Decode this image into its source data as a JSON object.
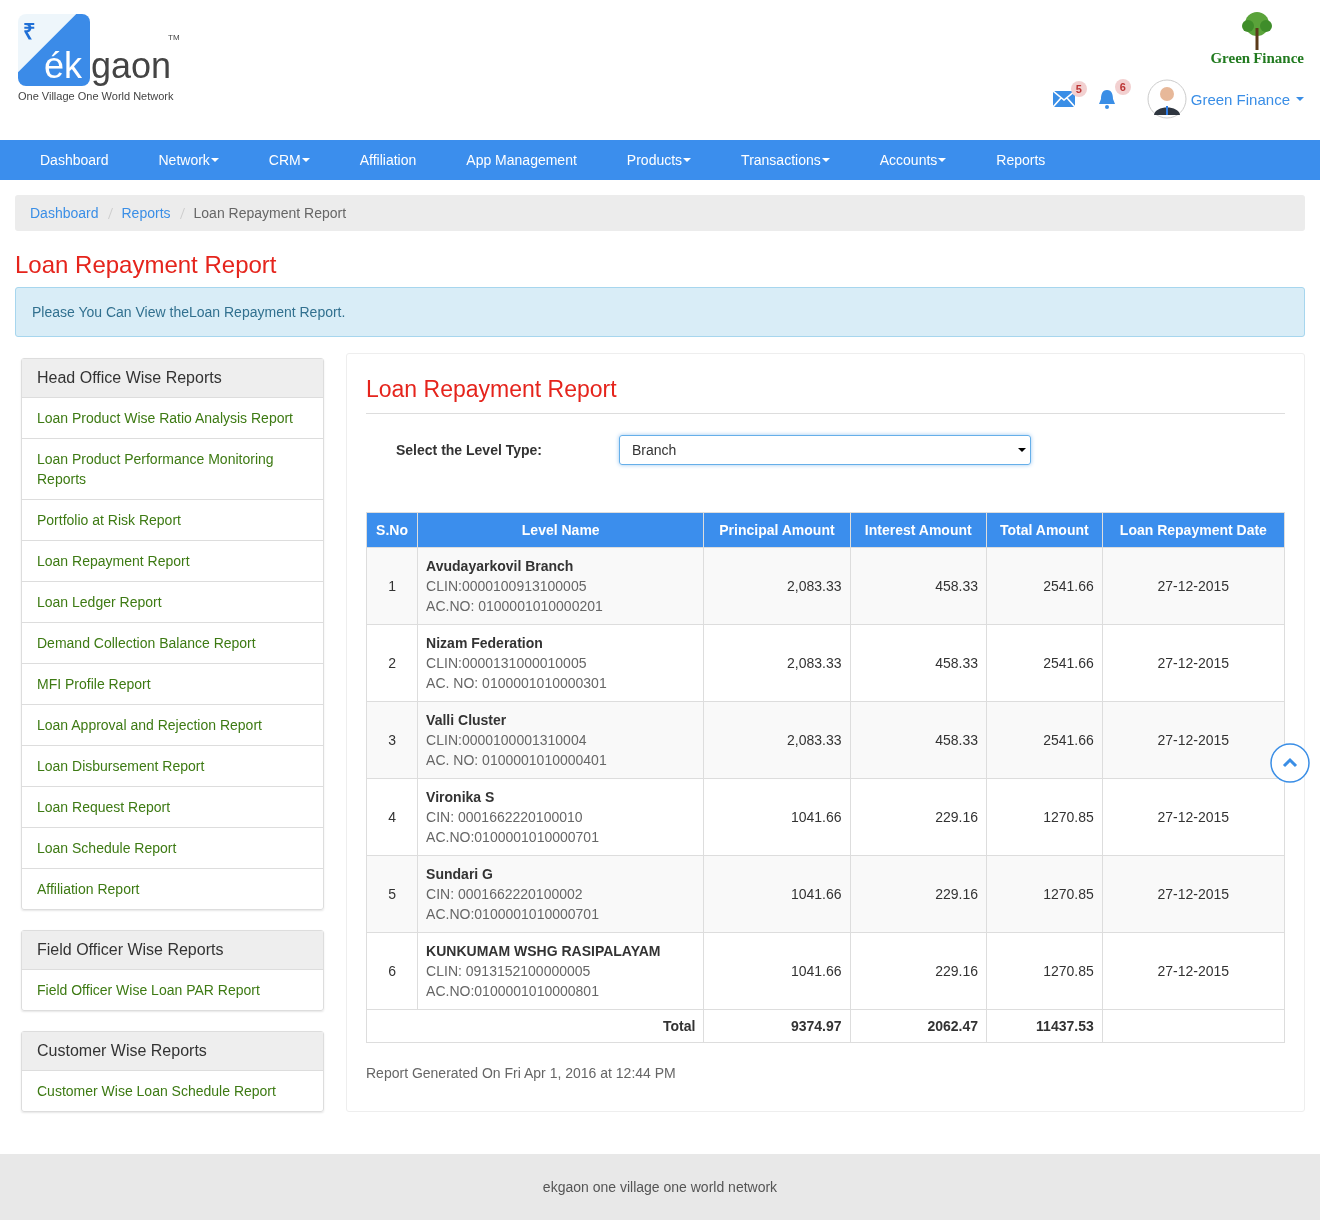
{
  "logo": {
    "rupee": "₹",
    "ek": "ék",
    "gaon": "gaon",
    "tm": "TM",
    "tagline": "One Village One World Network"
  },
  "partner_logo": {
    "word1": "Green",
    "word2": "Finance"
  },
  "header": {
    "mail_count": "5",
    "alert_count": "6",
    "user": "Green Finance"
  },
  "nav": [
    {
      "label": "Dashboard",
      "dropdown": false
    },
    {
      "label": "Network",
      "dropdown": true
    },
    {
      "label": "CRM",
      "dropdown": true
    },
    {
      "label": "Affiliation",
      "dropdown": false
    },
    {
      "label": "App Management",
      "dropdown": false
    },
    {
      "label": "Products",
      "dropdown": true
    },
    {
      "label": "Transactions",
      "dropdown": true
    },
    {
      "label": "Accounts",
      "dropdown": true
    },
    {
      "label": "Reports",
      "dropdown": false
    }
  ],
  "breadcrumb": [
    {
      "label": "Dashboard",
      "current": false
    },
    {
      "label": "Reports",
      "current": false
    },
    {
      "label": "Loan Repayment Report",
      "current": true
    }
  ],
  "page_title": "Loan Repayment Report",
  "info": "Please You Can View theLoan Repayment Report.",
  "sidebar": [
    {
      "title": "Head Office Wise Reports",
      "items": [
        "Loan Product Wise Ratio Analysis Report",
        "Loan Product Performance Monitoring Reports",
        "Portfolio at Risk Report",
        "Loan Repayment Report",
        "Loan Ledger Report",
        "Demand Collection Balance Report",
        "MFI Profile Report",
        "Loan Approval and Rejection Report",
        "Loan Disbursement Report",
        "Loan Request Report",
        "Loan Schedule Report",
        "Affiliation Report"
      ]
    },
    {
      "title": "Field Officer Wise Reports",
      "items": [
        "Field Officer Wise Loan PAR Report"
      ]
    },
    {
      "title": "Customer Wise Reports",
      "items": [
        "Customer Wise Loan Schedule Report"
      ]
    }
  ],
  "panel": {
    "title": "Loan Repayment Report",
    "level_label": "Select the Level Type:",
    "level_value": "Branch",
    "columns": [
      "S.No",
      "Level Name",
      "Principal Amount",
      "Interest Amount",
      "Total Amount",
      "Loan Repayment Date"
    ],
    "rows": [
      {
        "sno": "1",
        "name": "Avudayarkovil Branch",
        "line1": "CLIN:0000100913100005",
        "line2": "AC.NO: 0100001010000201",
        "principal": "2,083.33",
        "interest": "458.33",
        "total": "2541.66",
        "date": "27-12-2015"
      },
      {
        "sno": "2",
        "name": "Nizam Federation",
        "line1": "CLIN:0000131000010005",
        "line2": "AC. NO: 0100001010000301",
        "principal": "2,083.33",
        "interest": "458.33",
        "total": "2541.66",
        "date": "27-12-2015"
      },
      {
        "sno": "3",
        "name": "Valli Cluster",
        "line1": "CLIN:0000100001310004",
        "line2": "AC. NO: 0100001010000401",
        "principal": "2,083.33",
        "interest": "458.33",
        "total": "2541.66",
        "date": "27-12-2015"
      },
      {
        "sno": "4",
        "name": "Vironika S",
        "line1": "CIN: 0001662220100010",
        "line2": "AC.NO:0100001010000701",
        "principal": "1041.66",
        "interest": "229.16",
        "total": "1270.85",
        "date": "27-12-2015"
      },
      {
        "sno": "5",
        "name": "Sundari G",
        "line1": "CIN: 0001662220100002",
        "line2": "AC.NO:0100001010000701",
        "principal": "1041.66",
        "interest": "229.16",
        "total": "1270.85",
        "date": "27-12-2015"
      },
      {
        "sno": "6",
        "name": "KUNKUMAM WSHG RASIPALAYAM",
        "line1": "CLIN: 0913152100000005",
        "line2": "AC.NO:0100001010000801",
        "principal": "1041.66",
        "interest": "229.16",
        "total": "1270.85",
        "date": "27-12-2015"
      }
    ],
    "total": {
      "label": "Total",
      "principal": "9374.97",
      "interest": "2062.47",
      "total": "11437.53"
    },
    "generated": "Report Generated On Fri Apr 1, 2016 at 12:44 PM"
  },
  "footer": "ekgaon one village one world network"
}
